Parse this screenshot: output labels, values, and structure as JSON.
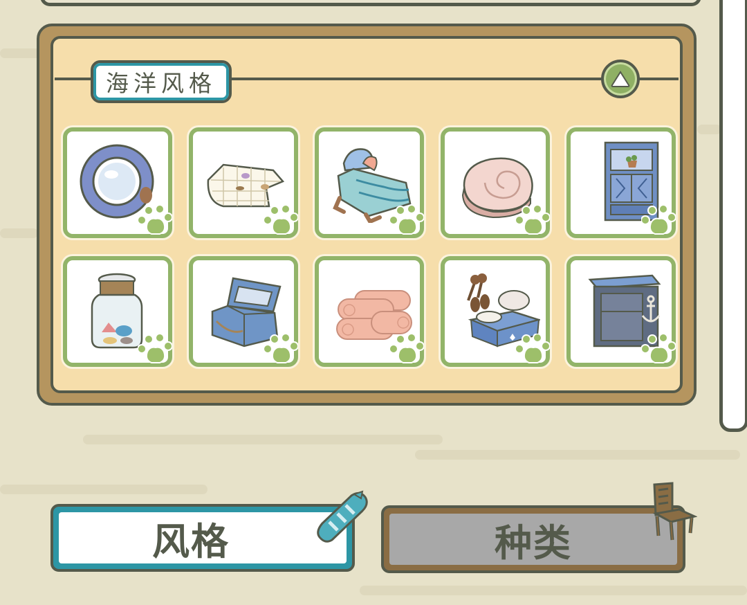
{
  "section": {
    "title": "海洋风格",
    "collapse_icon": "triangle-up-icon",
    "items": [
      {
        "name": "porthole-mirror-icon"
      },
      {
        "name": "fishing-net-icon"
      },
      {
        "name": "shell-bed-icon"
      },
      {
        "name": "shell-cushion-icon"
      },
      {
        "name": "blue-cabinet-icon"
      },
      {
        "name": "sea-glass-jar-icon"
      },
      {
        "name": "treasure-chest-icon"
      },
      {
        "name": "rolled-towels-icon"
      },
      {
        "name": "seaside-table-icon"
      },
      {
        "name": "anchor-shelf-icon"
      }
    ],
    "badge_icon": "frog-paw-icon"
  },
  "tabs": {
    "style_label": "风格",
    "style_icon": "seashell-icon",
    "type_label": "种类",
    "type_icon": "chair-icon",
    "active": "style"
  },
  "colors": {
    "background": "#e7e2c9",
    "panel_frame": "#b5955f",
    "panel_fill": "#f6deab",
    "outline": "#545a4b",
    "tile_border": "#92b469",
    "accent_teal": "#2d96a5",
    "inactive_tab": "#a8a8a8"
  }
}
